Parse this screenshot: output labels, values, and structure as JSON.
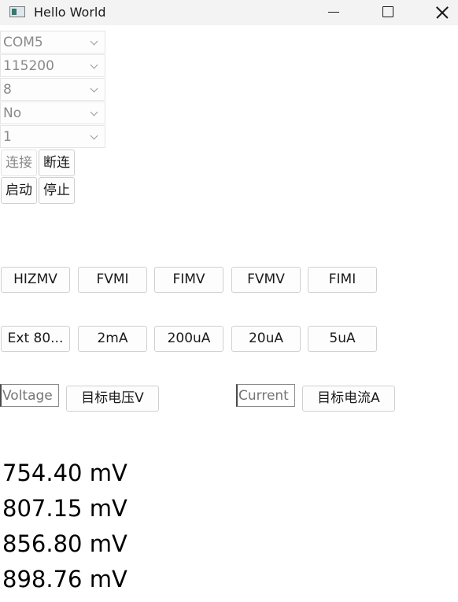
{
  "window": {
    "title": "Hello World"
  },
  "serial": {
    "port": "COM5",
    "baud": "115200",
    "data_bits": "8",
    "parity": "No",
    "stop_bits": "1",
    "connect_label": "连接",
    "disconnect_label": "断连",
    "start_label": "启动",
    "stop_label": "停止"
  },
  "modes": [
    "HIZMV",
    "FVMI",
    "FIMV",
    "FVMV",
    "FIMI"
  ],
  "ranges": [
    "Ext 80...",
    "2mA",
    "200uA",
    "20uA",
    "5uA"
  ],
  "targets": {
    "voltage_placeholder": "Voltage",
    "voltage_button": "目标电压V",
    "current_placeholder": "Current",
    "current_button": "目标电流A"
  },
  "readings": [
    "754.40 mV",
    "807.15 mV",
    "856.80 mV",
    "898.76 mV"
  ],
  "icons": {
    "app": "app-window-icon",
    "minimize": "minimize-icon",
    "maximize": "maximize-icon",
    "close": "close-icon",
    "dropdown": "chevron-down-icon"
  }
}
